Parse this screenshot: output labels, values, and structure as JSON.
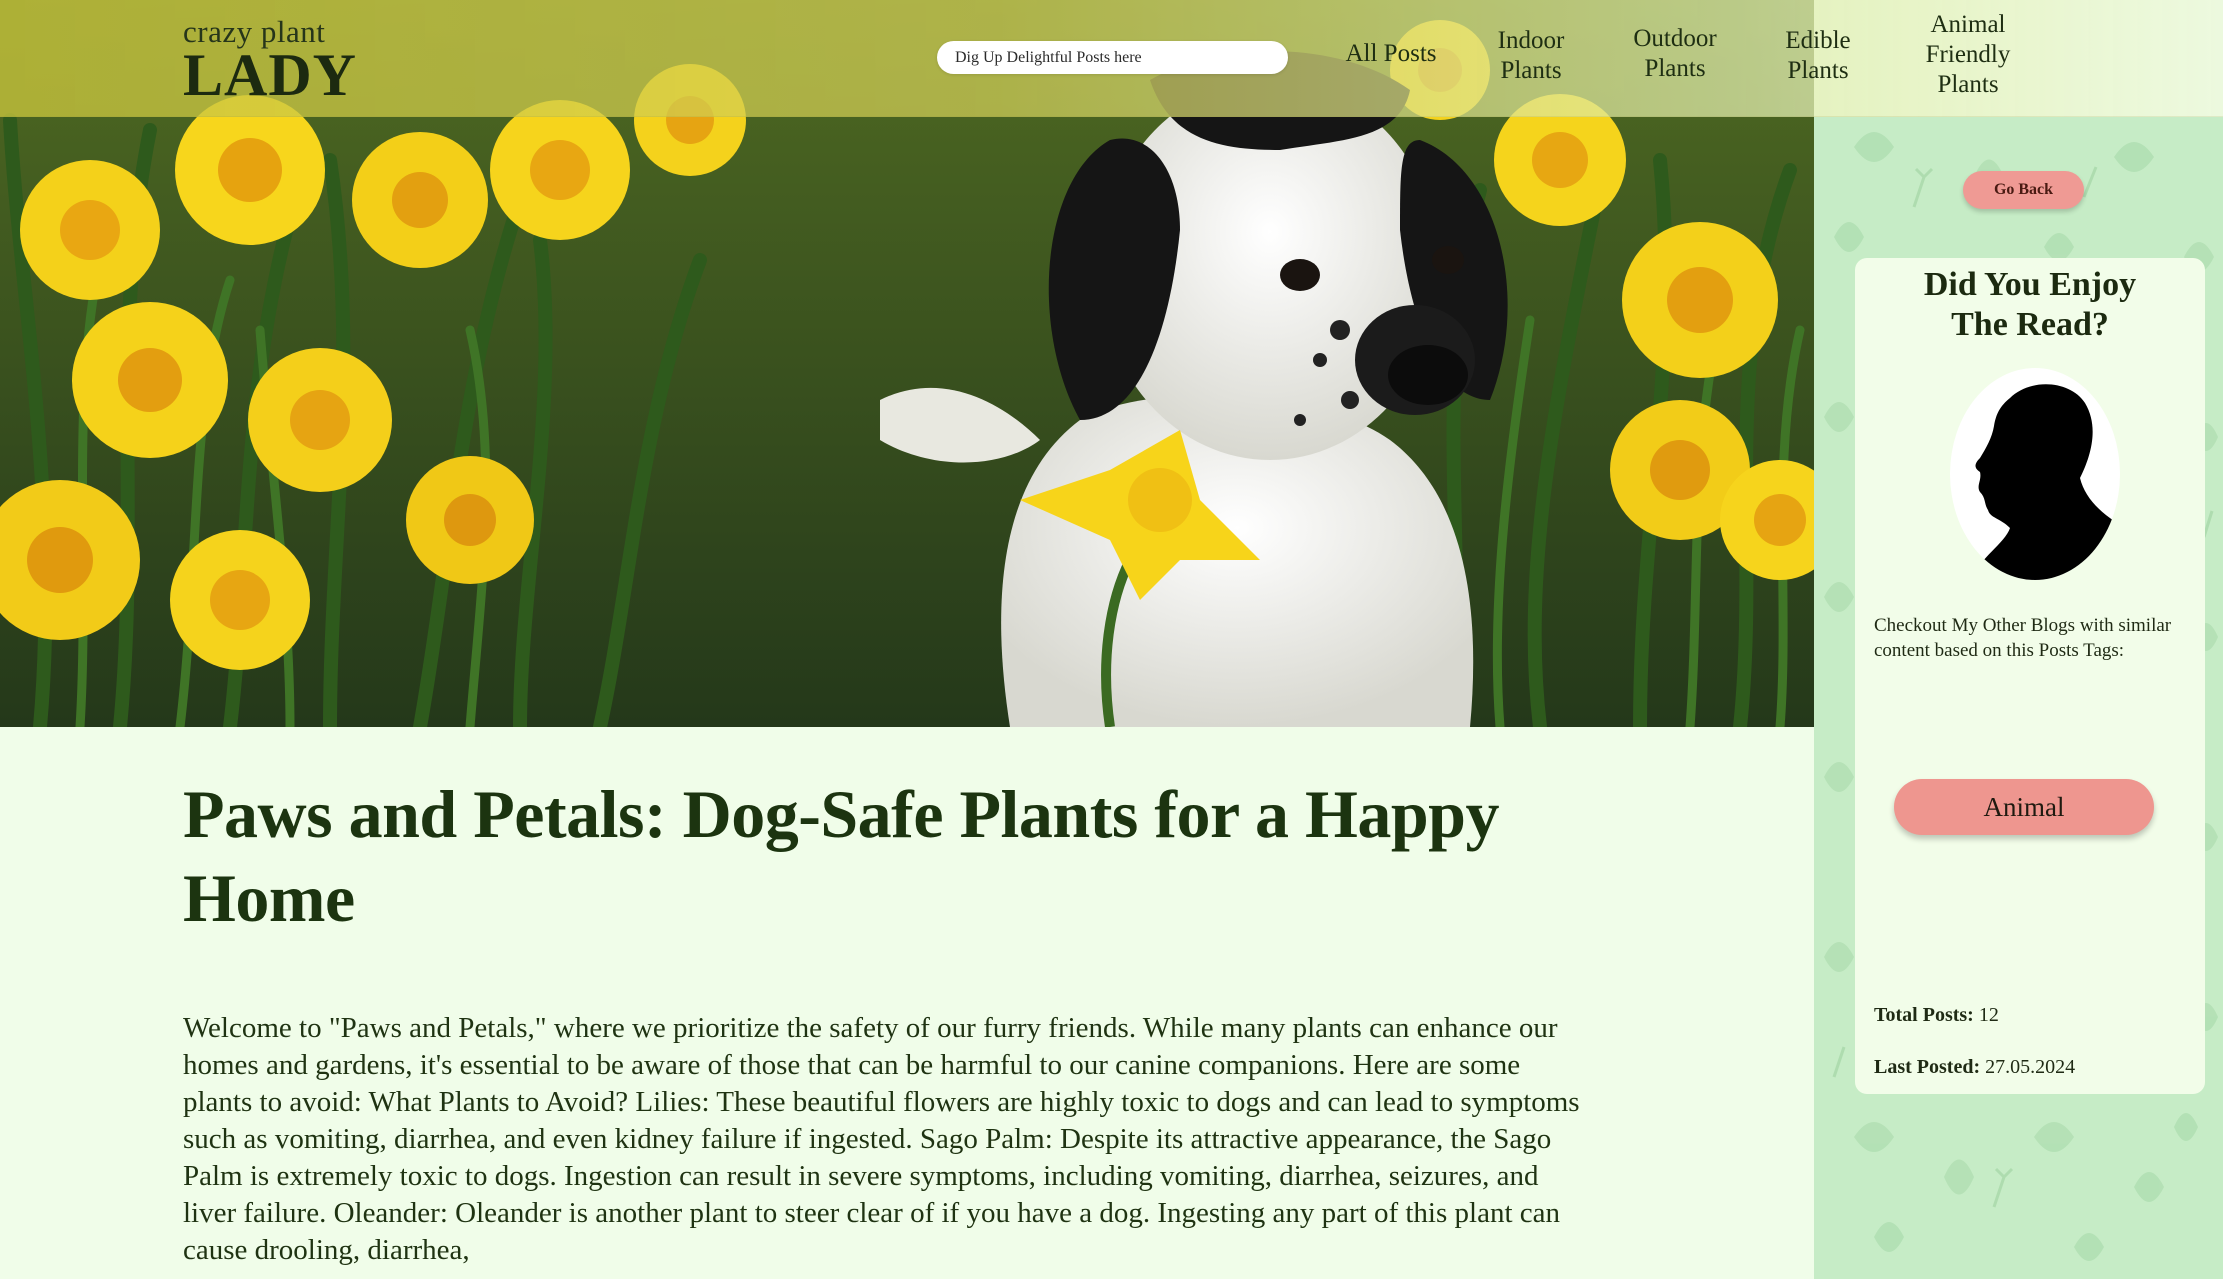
{
  "header": {
    "logo_small": "crazy plant",
    "logo_big": "LADY",
    "search_placeholder": "Dig Up Delightful Posts here",
    "nav": [
      {
        "label": "All Posts"
      },
      {
        "label": "Indoor\nPlants"
      },
      {
        "label": "Outdoor\nPlants"
      },
      {
        "label": "Edible\nPlants"
      },
      {
        "label": "Animal\nFriendly\nPlants"
      }
    ]
  },
  "hero": {
    "icon": "dog-in-daffodils-photo"
  },
  "article": {
    "title": "Paws and Petals: Dog-Safe Plants for a Happy Home",
    "body": "Welcome to \"Paws and Petals,\" where we prioritize the safety of our furry friends. While many plants can enhance our homes and gardens, it's essential to be aware of those that can be harmful to our canine companions. Here are some plants to avoid: What Plants to Avoid? Lilies: These beautiful flowers are highly toxic to dogs and can lead to symptoms such as vomiting, diarrhea, and even kidney failure if ingested. Sago Palm: Despite its attractive appearance, the Sago Palm is extremely toxic to dogs. Ingestion can result in severe symptoms, including vomiting, diarrhea, seizures, and liver failure. Oleander: Oleander is another plant to steer clear of if you have a dog. Ingesting any part of this plant can cause drooling, diarrhea,"
  },
  "sidebar": {
    "go_back": "Go Back",
    "card_heading": "Did You Enjoy\nThe Read?",
    "avatar_icon": "woman-silhouette-avatar",
    "blurb": "Checkout My Other Blogs with similar content based on this Posts Tags:",
    "tag": "Animal",
    "total_posts_label": "Total Posts:",
    "total_posts_value": "12",
    "last_posted_label": "Last Posted:",
    "last_posted_value": "27.05.2024"
  },
  "colors": {
    "page_bg": "#f0fde9",
    "sidebar_bg": "#c6ecc6",
    "button_pink": "#ef9a94",
    "title_green": "#1c3410"
  }
}
